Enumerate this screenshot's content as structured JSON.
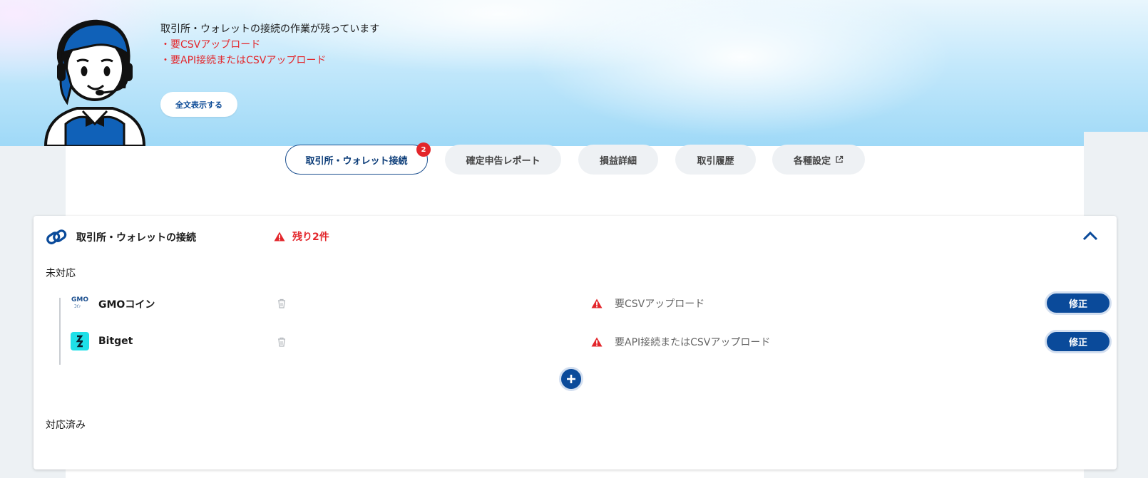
{
  "banner": {
    "message": "取引所・ウォレットの接続の作業が残っています",
    "todos": [
      "・要CSVアップロード",
      "・要API接続またはCSVアップロード"
    ],
    "fulltext_button": "全文表示する"
  },
  "tabs": [
    {
      "label": "取引所・ウォレット接続",
      "badge": "2",
      "active": true
    },
    {
      "label": "確定申告レポート"
    },
    {
      "label": "損益詳細"
    },
    {
      "label": "取引履歴"
    },
    {
      "label": "各種設定"
    }
  ],
  "card": {
    "title": "取引所・ウォレットの接続",
    "remaining": "残り2件",
    "pending_label": "未対応",
    "done_label": "対応済み",
    "rows": [
      {
        "name": "GMOコイン",
        "status": "要CSVアップロード",
        "button": "修正"
      },
      {
        "name": "Bitget",
        "status": "要API接続またはCSVアップロード",
        "button": "修正"
      }
    ]
  },
  "colors": {
    "accent": "#0a4a9a",
    "alert": "#e3262b"
  },
  "icons": [
    "link-icon",
    "warning-icon",
    "chevron-up-icon",
    "trash-icon",
    "plus-icon",
    "external-link-icon"
  ]
}
